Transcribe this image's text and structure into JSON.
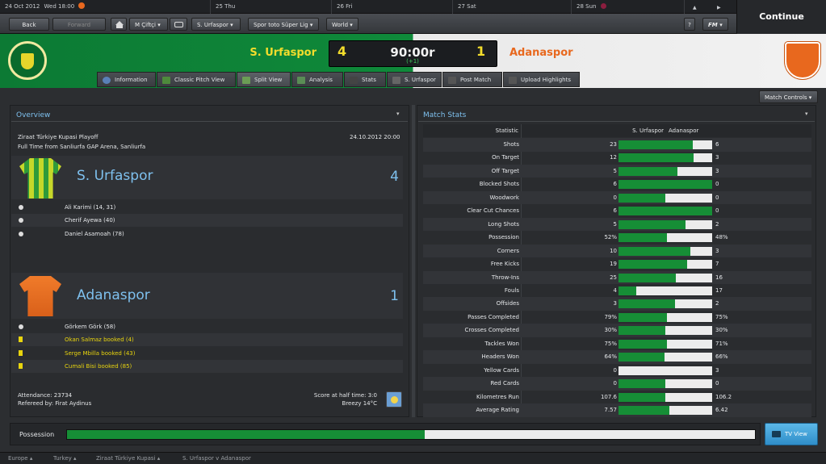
{
  "topbar": {
    "date": "24 Oct 2012",
    "time": "Wed 18:00",
    "days": [
      "25 Thu",
      "26 Fri",
      "27 Sat",
      "28 Sun"
    ]
  },
  "continue_label": "Continue",
  "nav": {
    "back": "Back",
    "forward": "Forward",
    "manager": "M Çiftçi",
    "club": "S. Urfaspor",
    "league": "Spor toto Süper Lig",
    "world": "World",
    "help": "?",
    "fm": "FM"
  },
  "match": {
    "home_team": "S. Urfaspor",
    "away_team": "Adanaspor",
    "home_score": "4",
    "away_score": "1",
    "clock": "90:00r",
    "added": "(+1)"
  },
  "tabs": [
    "Information",
    "Classic Pitch View",
    "Split View",
    "Analysis",
    "Stats",
    "S. Urfaspor",
    "Post Match",
    "Upload Highlights"
  ],
  "match_controls": "Match Controls",
  "overview": {
    "title": "Overview",
    "competition": "Ziraat Türkiye Kupasi Playoff",
    "datetime": "24.10.2012 20:00",
    "venue": "Full Time from Sanliurfa GAP Arena, Sanliurfa",
    "home_name": "S. Urfaspor",
    "home_score": "4",
    "home_events": [
      {
        "type": "goal",
        "text": "Ali Karimi (14, 31)"
      },
      {
        "type": "goal",
        "text": "Cherif Ayewa (40)"
      },
      {
        "type": "goal",
        "text": "Daniel Asamoah (78)"
      }
    ],
    "away_name": "Adanaspor",
    "away_score": "1",
    "away_events": [
      {
        "type": "goal",
        "text": "Görkem Görk (58)"
      },
      {
        "type": "booking",
        "text": "Okan Salmaz booked (4)"
      },
      {
        "type": "booking",
        "text": "Serge Mbilla booked (43)"
      },
      {
        "type": "booking",
        "text": "Cumali Bisi booked (85)"
      }
    ],
    "attendance": "Attendance: 23734",
    "referee": "Refereed by: Firat Aydinus",
    "halftime": "Score at half time: 3:0",
    "weather": "Breezy 14°C"
  },
  "stats": {
    "title": "Match Stats",
    "col_stat": "Statistic",
    "col_home": "S. Urfaspor",
    "col_away": "Adanaspor",
    "rows": [
      {
        "label": "Shots",
        "home": "23",
        "away": "6",
        "hv": 23,
        "av": 6
      },
      {
        "label": "On Target",
        "home": "12",
        "away": "3",
        "hv": 12,
        "av": 3
      },
      {
        "label": "Off Target",
        "home": "5",
        "away": "3",
        "hv": 5,
        "av": 3
      },
      {
        "label": "Blocked Shots",
        "home": "6",
        "away": "0",
        "hv": 6,
        "av": 0
      },
      {
        "label": "Woodwork",
        "home": "0",
        "away": "0",
        "hv": 0,
        "av": 0
      },
      {
        "label": "Clear Cut Chances",
        "home": "6",
        "away": "0",
        "hv": 6,
        "av": 0
      },
      {
        "label": "Long Shots",
        "home": "5",
        "away": "2",
        "hv": 5,
        "av": 2
      },
      {
        "label": "Possession",
        "home": "52%",
        "away": "48%",
        "hv": 52,
        "av": 48
      },
      {
        "label": "Corners",
        "home": "10",
        "away": "3",
        "hv": 10,
        "av": 3
      },
      {
        "label": "Free Kicks",
        "home": "19",
        "away": "7",
        "hv": 19,
        "av": 7
      },
      {
        "label": "Throw-Ins",
        "home": "25",
        "away": "16",
        "hv": 25,
        "av": 16
      },
      {
        "label": "Fouls",
        "home": "4",
        "away": "17",
        "hv": 4,
        "av": 17
      },
      {
        "label": "Offsides",
        "home": "3",
        "away": "2",
        "hv": 3,
        "av": 2
      },
      {
        "label": "Passes Completed",
        "home": "79%",
        "away": "75%",
        "hv": 79,
        "av": 75
      },
      {
        "label": "Crosses Completed",
        "home": "30%",
        "away": "30%",
        "hv": 30,
        "av": 30
      },
      {
        "label": "Tackles Won",
        "home": "75%",
        "away": "71%",
        "hv": 75,
        "av": 71
      },
      {
        "label": "Headers Won",
        "home": "64%",
        "away": "66%",
        "hv": 64,
        "av": 66
      },
      {
        "label": "Yellow Cards",
        "home": "0",
        "away": "3",
        "hv": 0,
        "av": 3
      },
      {
        "label": "Red Cards",
        "home": "0",
        "away": "0",
        "hv": 0,
        "av": 0
      },
      {
        "label": "Kilometres Run",
        "home": "107.6",
        "away": "106.2",
        "hv": 107.6,
        "av": 106.2
      },
      {
        "label": "Average Rating",
        "home": "7.57",
        "away": "6.42",
        "hv": 7.57,
        "av": 6.42
      }
    ]
  },
  "possession_bar": {
    "label": "Possession",
    "home_fraction": 0.52
  },
  "tv_view": "TV View",
  "breadcrumbs": [
    "Europe",
    "Turkey",
    "Ziraat Türkiye Kupasi",
    "S. Urfaspor v Adanaspor"
  ],
  "colors": {
    "home": "#168e36",
    "away": "#ececec",
    "accent": "#7ec0ee",
    "booking": "#e8d40e"
  }
}
